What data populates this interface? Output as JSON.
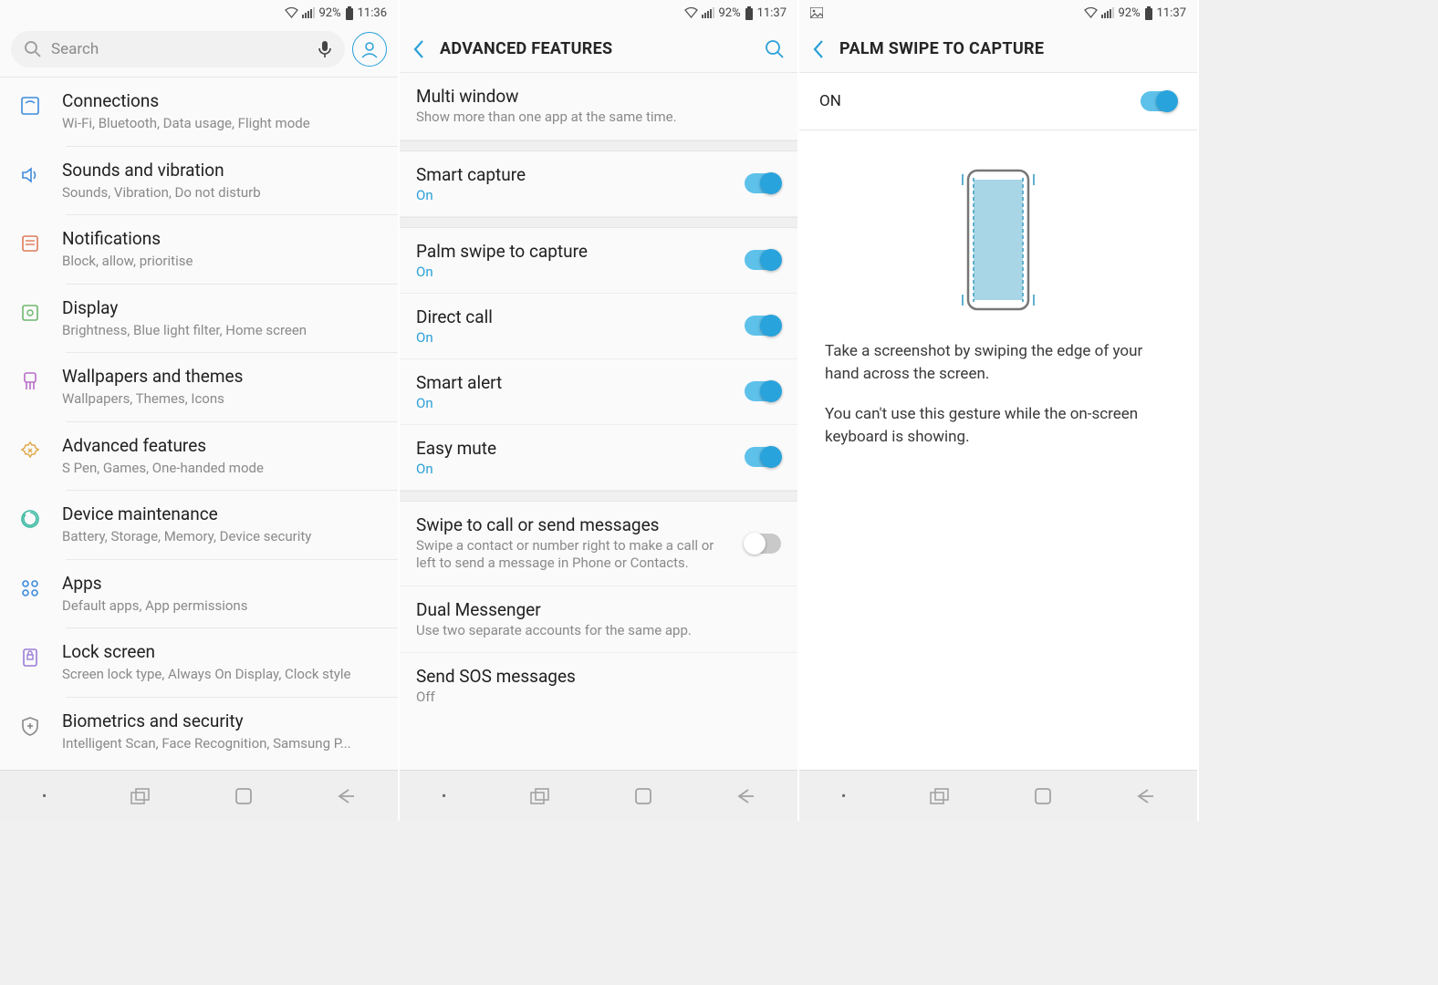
{
  "status": {
    "battery": "92%",
    "time1": "11:36",
    "time2": "11:37",
    "time3": "11:37"
  },
  "screen1": {
    "search_placeholder": "Search",
    "items": [
      {
        "title": "Connections",
        "sub": "Wi-Fi, Bluetooth, Data usage, Flight mode"
      },
      {
        "title": "Sounds and vibration",
        "sub": "Sounds, Vibration, Do not disturb"
      },
      {
        "title": "Notifications",
        "sub": "Block, allow, prioritise"
      },
      {
        "title": "Display",
        "sub": "Brightness, Blue light filter, Home screen"
      },
      {
        "title": "Wallpapers and themes",
        "sub": "Wallpapers, Themes, Icons"
      },
      {
        "title": "Advanced features",
        "sub": "S Pen, Games, One-handed mode"
      },
      {
        "title": "Device maintenance",
        "sub": "Battery, Storage, Memory, Device security"
      },
      {
        "title": "Apps",
        "sub": "Default apps, App permissions"
      },
      {
        "title": "Lock screen",
        "sub": "Screen lock type, Always On Display, Clock style"
      },
      {
        "title": "Biometrics and security",
        "sub": "Intelligent Scan, Face Recognition, Samsung P..."
      }
    ]
  },
  "screen2": {
    "title": "ADVANCED FEATURES",
    "items_top": [
      {
        "title": "Multi window",
        "sub": "Show more than one app at the same time."
      }
    ],
    "items_mid": [
      {
        "title": "Smart capture",
        "state": "On",
        "toggle": true
      },
      {
        "title": "Palm swipe to capture",
        "state": "On",
        "toggle": true
      },
      {
        "title": "Direct call",
        "state": "On",
        "toggle": true
      },
      {
        "title": "Smart alert",
        "state": "On",
        "toggle": true
      },
      {
        "title": "Easy mute",
        "state": "On",
        "toggle": true
      }
    ],
    "items_bot": [
      {
        "title": "Swipe to call or send messages",
        "sub": "Swipe a contact or number right to make a call or left to send a message in Phone or Contacts.",
        "toggle": false
      },
      {
        "title": "Dual Messenger",
        "sub": "Use two separate accounts for the same app."
      },
      {
        "title": "Send SOS messages",
        "state": "Off"
      }
    ]
  },
  "screen3": {
    "title": "PALM SWIPE TO CAPTURE",
    "on_label": "ON",
    "desc1": "Take a screenshot by swiping the edge of your hand across the screen.",
    "desc2": "You can't use this gesture while the on-screen keyboard is showing."
  }
}
